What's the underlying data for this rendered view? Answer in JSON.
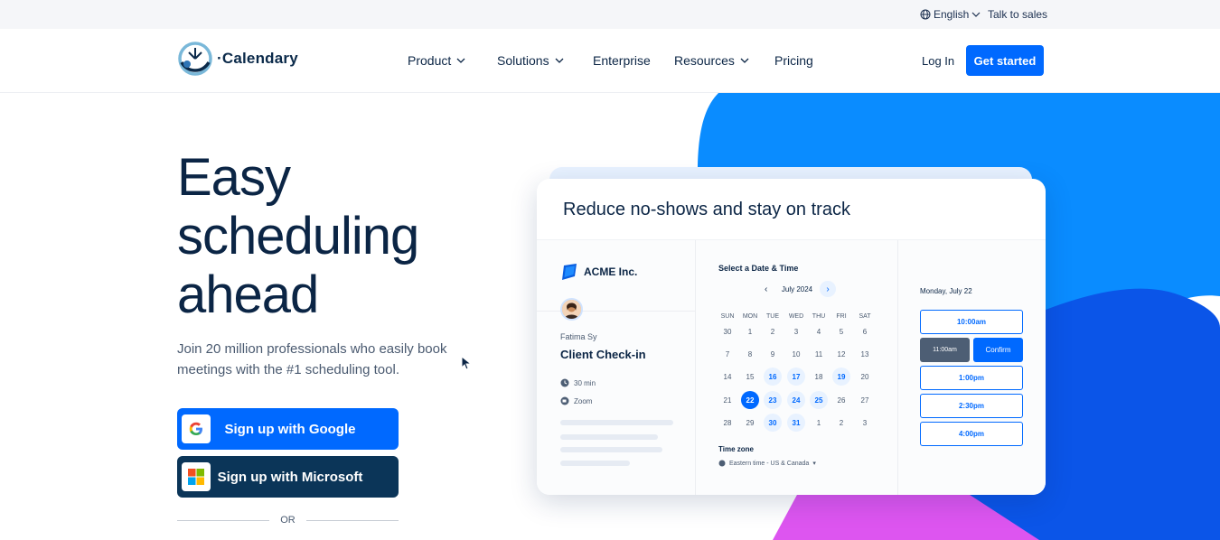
{
  "topbar": {
    "language": "English",
    "talk_to_sales": "Talk to sales"
  },
  "nav": {
    "brand": "Calendary",
    "items": [
      {
        "label": "Product",
        "dropdown": true
      },
      {
        "label": "Solutions",
        "dropdown": true
      },
      {
        "label": "Enterprise",
        "dropdown": false
      },
      {
        "label": "Resources",
        "dropdown": true
      },
      {
        "label": "Pricing",
        "dropdown": false
      }
    ],
    "login": "Log In",
    "get_started": "Get started"
  },
  "hero": {
    "title_lines": [
      "Easy",
      "scheduling",
      "ahead"
    ],
    "subtitle": "Join 20 million professionals who easily book meetings with the #1 scheduling tool.",
    "google_button": "Sign up with Google",
    "microsoft_button": "Sign up with Microsoft",
    "or": "OR"
  },
  "card": {
    "title": "Reduce no-shows and stay on track",
    "company": "ACME Inc.",
    "host": "Fatima Sy",
    "event": "Client Check-in",
    "duration": "30 min",
    "location": "Zoom",
    "select_label": "Select a Date & Time",
    "month": "July 2024",
    "weekdays": [
      "SUN",
      "MON",
      "TUE",
      "WED",
      "THU",
      "FRI",
      "SAT"
    ],
    "weeks": [
      [
        "30",
        "1",
        "2",
        "3",
        "4",
        "5",
        "6"
      ],
      [
        "7",
        "8",
        "9",
        "10",
        "11",
        "12",
        "13"
      ],
      [
        "14",
        "15",
        "16",
        "17",
        "18",
        "19",
        "20"
      ],
      [
        "21",
        "22",
        "23",
        "24",
        "25",
        "26",
        "27"
      ],
      [
        "28",
        "29",
        "30",
        "31",
        "1",
        "2",
        "3"
      ]
    ],
    "available_days": [
      "16",
      "17",
      "19",
      "23",
      "24",
      "25",
      "30",
      "31"
    ],
    "selected_day": "22",
    "timezone_label": "Time zone",
    "timezone_value": "Eastern time - US & Canada",
    "date_label": "Monday, July 22",
    "slots": [
      "10:00am",
      "1:00pm",
      "2:30pm",
      "4:00pm"
    ],
    "selected_slot": "11:00am",
    "confirm": "Confirm"
  },
  "colors": {
    "primary": "#0069ff",
    "navy": "#0b3558",
    "blob_blue": "#0a8cff",
    "blob_dark_blue": "#0b55e8",
    "blob_purple": "#dd55f0"
  }
}
